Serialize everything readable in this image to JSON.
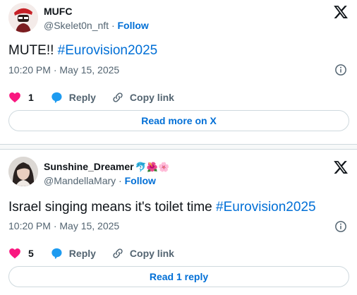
{
  "tweets": [
    {
      "name": "MUFC",
      "handle": "@Skelet0n_nft",
      "separator": "·",
      "follow": "Follow",
      "text_prefix": "MUTE!! ",
      "hashtag": "#Eurovision2025",
      "time": "10:20 PM · May 15, 2025",
      "likes": "1",
      "reply_label": "Reply",
      "copy_label": "Copy link",
      "pill_label": "Read more on X"
    },
    {
      "name": "Sunshine_Dreamer",
      "name_emojis": "🐬🌺🌸",
      "handle": "@MandellaMary",
      "separator": "·",
      "follow": "Follow",
      "text_prefix": "Israel singing means it's toilet time ",
      "hashtag": "#Eurovision2025",
      "time": "10:20 PM · May 15, 2025",
      "likes": "5",
      "reply_label": "Reply",
      "copy_label": "Copy link",
      "pill_label": "Read 1 reply"
    }
  ],
  "colors": {
    "like": "#f91880",
    "reply": "#1d9bf0",
    "link": "#006fd6",
    "muted": "#536471"
  },
  "icons": [
    "x-logo-icon",
    "info-icon",
    "heart-icon",
    "reply-bubble-icon",
    "link-icon"
  ]
}
